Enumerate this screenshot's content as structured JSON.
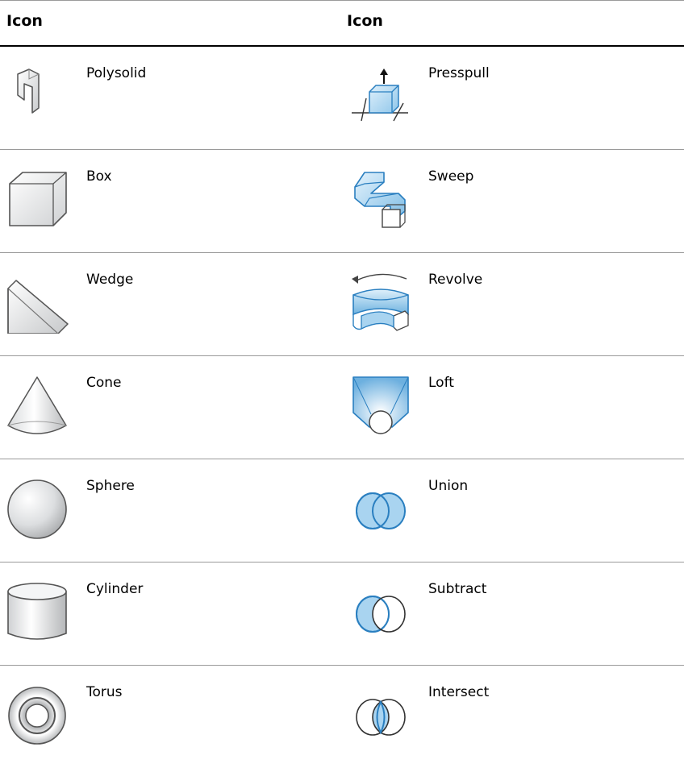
{
  "header": {
    "col1": "Icon",
    "col2": "Icon"
  },
  "rows": [
    {
      "left": {
        "label": "Polysolid",
        "icon": "polysolid-icon"
      },
      "right": {
        "label": "Presspull",
        "icon": "presspull-icon"
      }
    },
    {
      "left": {
        "label": "Box",
        "icon": "box-icon"
      },
      "right": {
        "label": "Sweep",
        "icon": "sweep-icon"
      }
    },
    {
      "left": {
        "label": "Wedge",
        "icon": "wedge-icon"
      },
      "right": {
        "label": "Revolve",
        "icon": "revolve-icon"
      }
    },
    {
      "left": {
        "label": "Cone",
        "icon": "cone-icon"
      },
      "right": {
        "label": "Loft",
        "icon": "loft-icon"
      }
    },
    {
      "left": {
        "label": "Sphere",
        "icon": "sphere-icon"
      },
      "right": {
        "label": "Union",
        "icon": "union-icon"
      }
    },
    {
      "left": {
        "label": "Cylinder",
        "icon": "cylinder-icon"
      },
      "right": {
        "label": "Subtract",
        "icon": "subtract-icon"
      }
    },
    {
      "left": {
        "label": "Torus",
        "icon": "torus-icon"
      },
      "right": {
        "label": "Intersect",
        "icon": "intersect-icon"
      }
    }
  ],
  "colors": {
    "accent_blue": "#5aa9dd",
    "light_blue": "#bfe0f4",
    "stroke_blue": "#2a7fc0",
    "gray_fill": "#e8e9ea",
    "gray_stroke": "#6b6b6b"
  }
}
